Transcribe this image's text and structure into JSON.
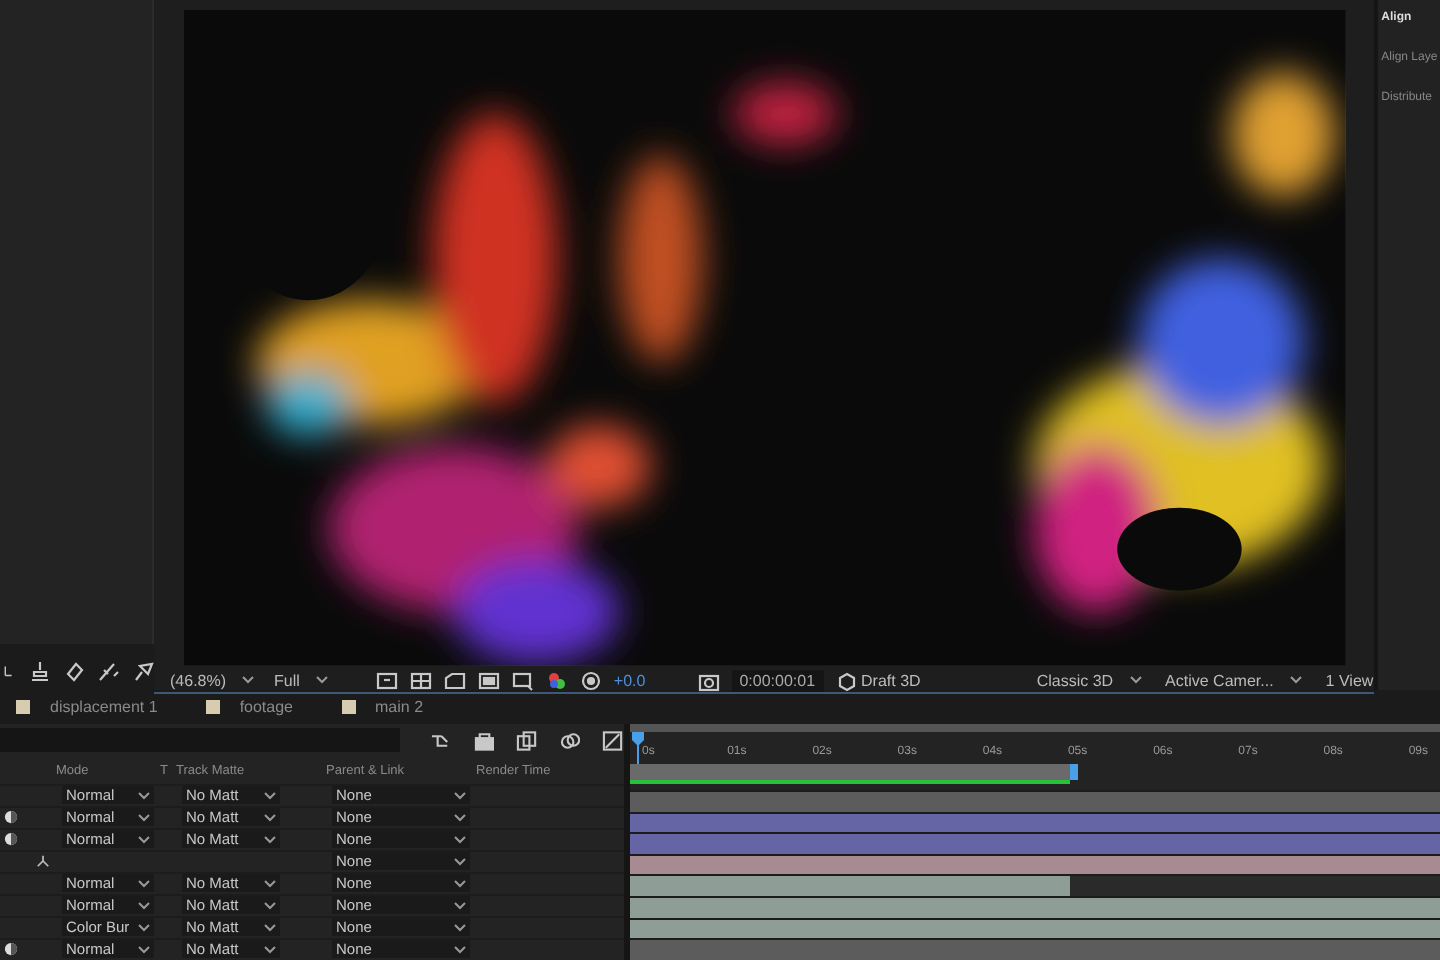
{
  "right_panel": {
    "title": "Align",
    "labels": [
      "Align Laye",
      "Distribute"
    ]
  },
  "viewer": {
    "zoom": "(46.8%)",
    "resolution": "Full",
    "exposure": "+0.0",
    "timecode": "0:00:00:01",
    "draft": "Draft 3D",
    "renderer": "Classic 3D",
    "camera": "Active Camer...",
    "views": "1 View"
  },
  "comp_tabs": [
    {
      "label": "displacement 1"
    },
    {
      "label": "footage"
    },
    {
      "label": "main 2"
    }
  ],
  "timeline": {
    "columns": [
      "Mode",
      "T",
      "Track Matte",
      "Parent & Link",
      "Render Time"
    ],
    "ruler": [
      "0s",
      "01s",
      "02s",
      "03s",
      "04s",
      "05s",
      "06s",
      "07s",
      "08s",
      "09s"
    ],
    "rows": [
      {
        "kind": "av",
        "switch": false,
        "mode": "Normal",
        "track_matte": "No Matt",
        "parent": "None",
        "color": "#5c5c5c",
        "trimmed": false
      },
      {
        "kind": "av",
        "switch": true,
        "mode": "Normal",
        "track_matte": "No Matt",
        "parent": "None",
        "color": "#6565a6",
        "trimmed": false
      },
      {
        "kind": "av",
        "switch": true,
        "mode": "Normal",
        "track_matte": "No Matt",
        "parent": "None",
        "color": "#6565a6",
        "trimmed": false
      },
      {
        "kind": "null",
        "switch": false,
        "parent": "None",
        "color": "#a88a92",
        "trimmed": false
      },
      {
        "kind": "av",
        "switch": false,
        "mode": "Normal",
        "track_matte": "No Matt",
        "parent": "None",
        "color": "#8e9e96",
        "trimmed": true
      },
      {
        "kind": "av",
        "switch": false,
        "mode": "Normal",
        "track_matte": "No Matt",
        "parent": "None",
        "color": "#8e9e96",
        "trimmed": false
      },
      {
        "kind": "av",
        "switch": false,
        "mode": "Color Bur",
        "track_matte": "No Matt",
        "parent": "None",
        "color": "#8e9e96",
        "trimmed": false
      },
      {
        "kind": "av",
        "switch": true,
        "mode": "Normal",
        "track_matte": "No Matt",
        "parent": "None",
        "color": "#5c5c5c",
        "trimmed": false
      }
    ]
  }
}
